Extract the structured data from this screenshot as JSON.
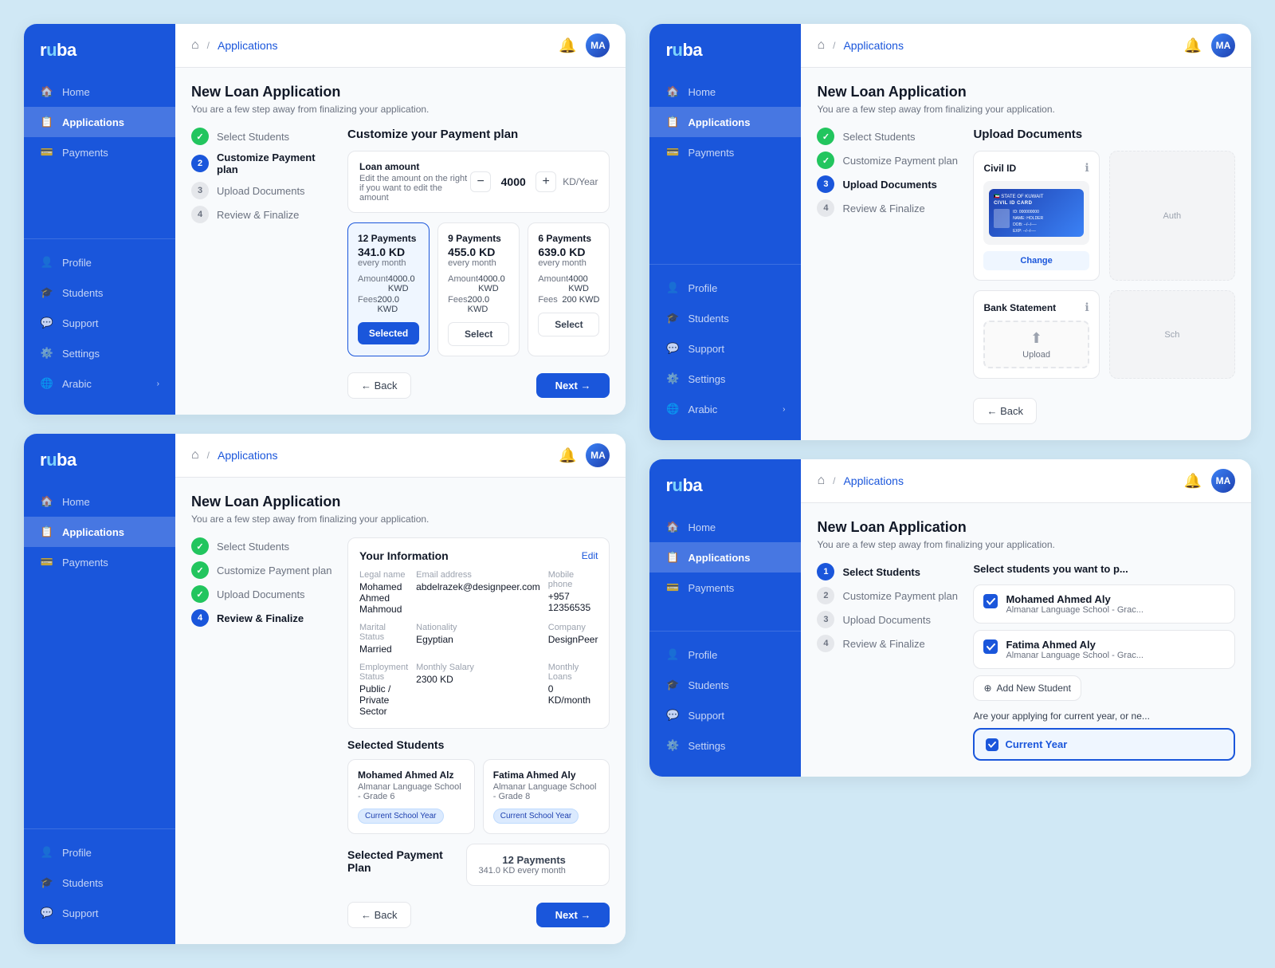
{
  "brand": "ruba",
  "panels": [
    {
      "id": "panel-payment",
      "topbar": {
        "title": "Applications",
        "home": "🏠"
      },
      "page_title": "New Loan Application",
      "page_subtitle": "You are a few step away from finalizing your application.",
      "steps": [
        {
          "num": "1",
          "label": "Select Students",
          "state": "done"
        },
        {
          "num": "2",
          "label": "Customize Payment plan",
          "state": "active"
        },
        {
          "num": "3",
          "label": "Upload Documents",
          "state": ""
        },
        {
          "num": "4",
          "label": "Review & Finalize",
          "state": ""
        }
      ],
      "section_title": "Customize your Payment plan",
      "loan_amount": {
        "label": "Loan amount",
        "desc": "Edit the amount on the right if you want to edit the amount",
        "value": "4000",
        "unit": "KD/Year"
      },
      "payment_options": [
        {
          "title": "12 Payments",
          "amount": "341.0 KD",
          "freq": "every month",
          "amount_label": "Amount",
          "amount_val": "4000.0 KWD",
          "fees_label": "Fees",
          "fees_val": "200.0 KWD",
          "selected": true,
          "btn": "Selected"
        },
        {
          "title": "9 Payments",
          "amount": "455.0 KD",
          "freq": "every month",
          "amount_label": "Amount",
          "amount_val": "4000.0 KWD",
          "fees_label": "Fees",
          "fees_val": "200.0 KWD",
          "selected": false,
          "btn": "Select"
        },
        {
          "title": "6 Payments",
          "amount": "639.0 KD",
          "freq": "every month",
          "amount_label": "Amount",
          "amount_val": "4000 KWD",
          "fees_label": "Fees",
          "fees_val": "200 KWD",
          "selected": false,
          "btn": "Select"
        }
      ],
      "btn_back": "← Back",
      "btn_next": "Next →",
      "sidebar_nav": [
        "Home",
        "Applications",
        "Payments"
      ],
      "sidebar_bottom": [
        "Profile",
        "Students",
        "Support",
        "Settings",
        "Arabic"
      ]
    },
    {
      "id": "panel-review",
      "topbar": {
        "title": "Applications",
        "home": "🏠"
      },
      "page_title": "New Loan Application",
      "page_subtitle": "You are a few step away from finalizing your application.",
      "steps": [
        {
          "num": "1",
          "label": "Select Students",
          "state": "done"
        },
        {
          "num": "2",
          "label": "Customize Payment plan",
          "state": "done"
        },
        {
          "num": "3",
          "label": "Upload Documents",
          "state": "done"
        },
        {
          "num": "4",
          "label": "Review & Finalize",
          "state": "active"
        }
      ],
      "info_title": "Your Information",
      "info_edit": "Edit",
      "info_fields": [
        {
          "label": "Legal name",
          "val": "Mohamed Ahmed Mahmoud"
        },
        {
          "label": "Email address",
          "val": "abdelrazek@designpeer.com"
        },
        {
          "label": "Mobile phone",
          "val": "+957 12356535"
        },
        {
          "label": "Marital Status",
          "val": "Married"
        },
        {
          "label": "Nationality",
          "val": "Egyptian"
        },
        {
          "label": "Company",
          "val": "DesignPeer"
        },
        {
          "label": "Employment Status",
          "val": "Public / Private Sector"
        },
        {
          "label": "Monthly Salary",
          "val": "2300 KD"
        },
        {
          "label": "Monthly Loans",
          "val": "0 KD/month"
        }
      ],
      "students_title": "Selected Students",
      "students": [
        {
          "name": "Mohamed Ahmed Alz",
          "school": "Almanar Language School - Grade 6",
          "badge": "Current School Year"
        },
        {
          "name": "Fatima Ahmed Aly",
          "school": "Almanar Language School - Grade 8",
          "badge": "Current School Year"
        }
      ],
      "payment_plan_title": "Selected Payment Plan",
      "payment_plan_val": "12 Payments",
      "payment_plan_sub": "341.0 KD every month",
      "btn_back": "← Back",
      "btn_next": "Next →",
      "sidebar_nav": [
        "Home",
        "Applications",
        "Payments"
      ],
      "sidebar_bottom": [
        "Profile",
        "Students",
        "Support"
      ]
    },
    {
      "id": "panel-upload",
      "topbar": {
        "title": "Applications",
        "home": "🏠"
      },
      "page_title": "New Loan Application",
      "page_subtitle": "You are a few step away from finalizing your application.",
      "steps": [
        {
          "num": "1",
          "label": "Select Students",
          "state": "done"
        },
        {
          "num": "2",
          "label": "Customize Payment plan",
          "state": "done"
        },
        {
          "num": "3",
          "label": "Upload Documents",
          "state": "active"
        },
        {
          "num": "4",
          "label": "Review & Finalize",
          "state": ""
        }
      ],
      "upload_title": "Upload Documents",
      "docs": [
        {
          "title": "Civil ID",
          "has_image": true,
          "change_btn": "Change",
          "auth_label": "Auth"
        },
        {
          "title": "Bank Statement",
          "has_image": false,
          "upload_btn": "Upload",
          "sch_label": "Sch"
        }
      ],
      "btn_back": "← Back",
      "sidebar_nav": [
        "Home",
        "Applications",
        "Payments"
      ],
      "sidebar_bottom": [
        "Profile",
        "Students",
        "Support",
        "Settings",
        "Arabic"
      ]
    },
    {
      "id": "panel-select",
      "topbar": {
        "title": "Applications",
        "home": "🏠"
      },
      "page_title": "New Loan Application",
      "page_subtitle": "You are a few step away from finalizing your application.",
      "steps": [
        {
          "num": "1",
          "label": "Select Students",
          "state": "active"
        },
        {
          "num": "2",
          "label": "Customize Payment plan",
          "state": ""
        },
        {
          "num": "3",
          "label": "Upload Documents",
          "state": ""
        },
        {
          "num": "4",
          "label": "Review & Finalize",
          "state": ""
        }
      ],
      "select_title": "Select students you want to p...",
      "students": [
        {
          "name": "Mohamed Ahmed Aly",
          "school": "Almanar Language School - Grac..."
        },
        {
          "name": "Fatima Ahmed Aly",
          "school": "Almanar Language School - Grac..."
        }
      ],
      "add_student_btn": "+ Add New Student",
      "year_question": "Are your applying for current year, or ne...",
      "current_year_btn": "Current Year",
      "sidebar_nav": [
        "Home",
        "Applications",
        "Payments"
      ],
      "sidebar_bottom": [
        "Profile",
        "Students",
        "Support",
        "Settings"
      ]
    }
  ]
}
